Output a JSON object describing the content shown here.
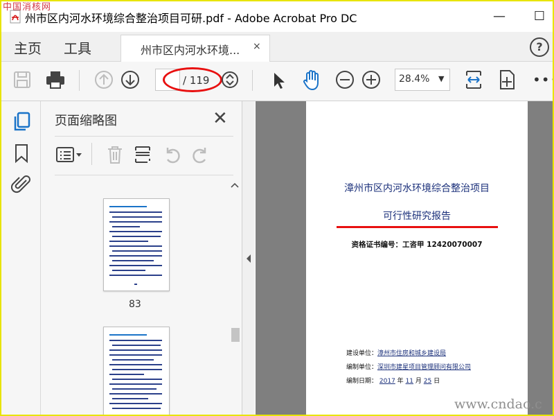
{
  "watermark_top": "中国消核网",
  "window": {
    "title": "州市区内河水环境综合整治项目可研.pdf - Adobe Acrobat Pro DC",
    "minimize_label": "—",
    "maximize_label": "☐"
  },
  "menu": {
    "home": "主页",
    "tools": "工具"
  },
  "tab": {
    "label": "州市区内河水环境...",
    "close": "×"
  },
  "help_label": "?",
  "toolbar": {
    "page_current": "",
    "page_count": "/ 119",
    "zoom": "28.4%",
    "zoom_caret": "▼",
    "more": "•••"
  },
  "panel": {
    "title": "页面缩略图",
    "close": "✕",
    "thumb_label": "83"
  },
  "document": {
    "title": "漳州市区内河水环境综合整治项目",
    "subtitle": "可行性研究报告",
    "cert_label": "资格证书编号：工咨甲 12420070007",
    "builder_label": "建设单位：",
    "builder_value": "漳州市住房和城乡建设局",
    "author_label": "编制单位：",
    "author_value": "深圳市建星项目管理顾问有限公司",
    "date_label": "编制日期：",
    "date_year": "2017",
    "date_year_unit": "年",
    "date_month": "11",
    "date_month_unit": "月",
    "date_day": "25",
    "date_day_unit": "日"
  },
  "watermark_bottom": "www.cndao.c",
  "colors": {
    "accent": "#1a73c8",
    "highlight": "#e81010",
    "frame": "#e8e400"
  }
}
